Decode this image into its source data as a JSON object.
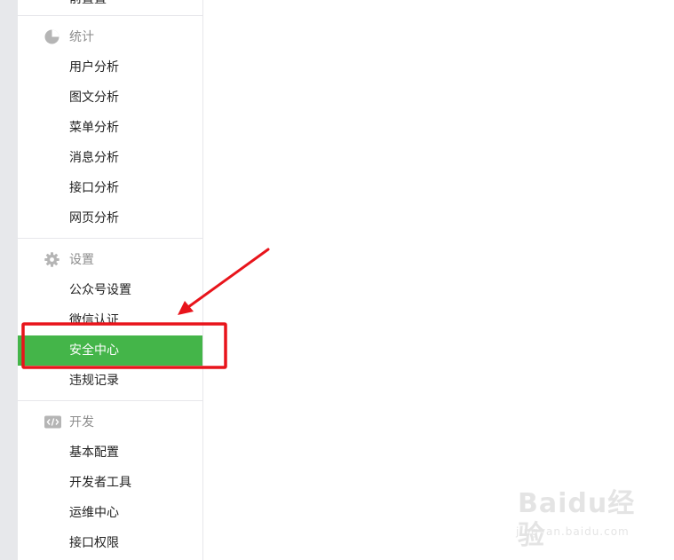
{
  "sidebar": {
    "cut_item": "前置置",
    "sections": [
      {
        "title": "统计",
        "icon": "pie-chart-icon",
        "items": [
          "用户分析",
          "图文分析",
          "菜单分析",
          "消息分析",
          "接口分析",
          "网页分析"
        ]
      },
      {
        "title": "设置",
        "icon": "gear-icon",
        "items": [
          "公众号设置",
          "微信认证",
          "安全中心",
          "违规记录"
        ]
      },
      {
        "title": "开发",
        "icon": "code-icon",
        "items": [
          "基本配置",
          "开发者工具",
          "运维中心",
          "接口权限"
        ]
      }
    ],
    "active_item": "安全中心"
  },
  "annotation": {
    "highlight_color": "#e8141b",
    "active_color": "#44b549"
  },
  "watermark": {
    "brand": "Baidu经验",
    "url": "jingyan.baidu.com"
  }
}
